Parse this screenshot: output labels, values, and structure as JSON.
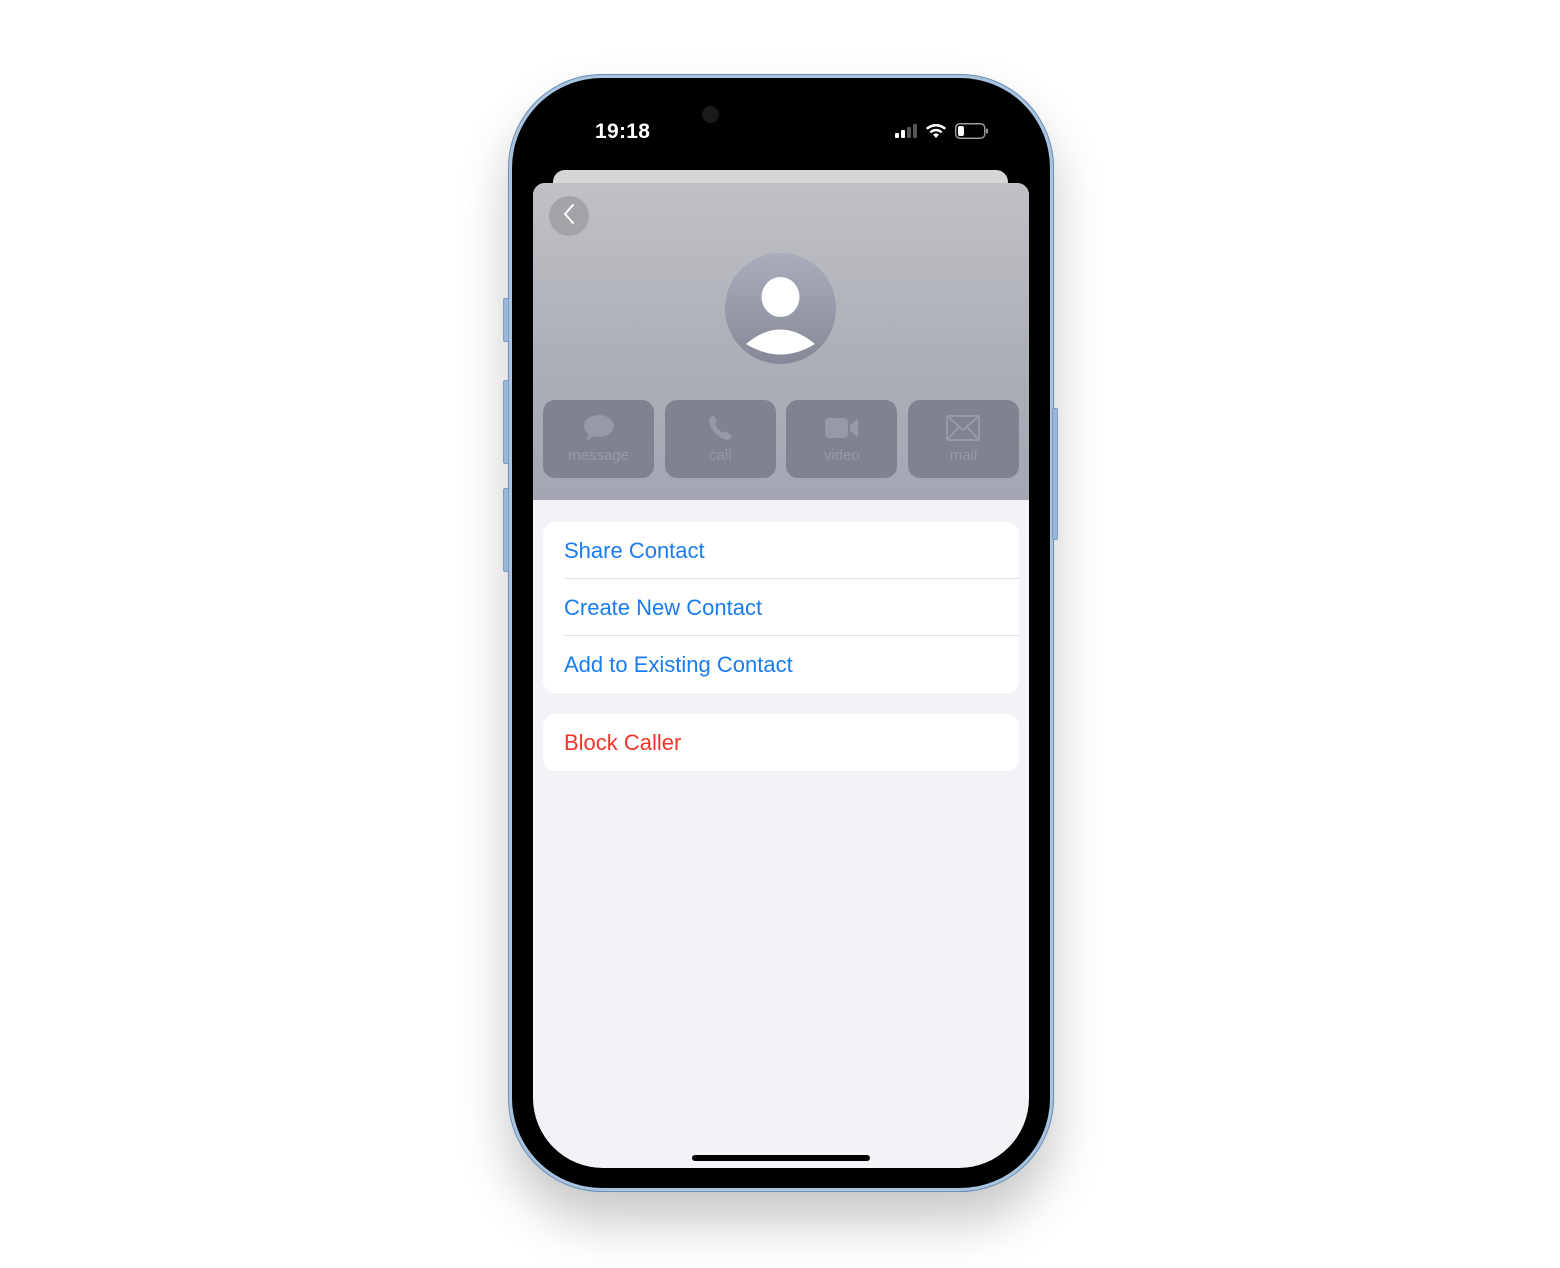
{
  "status_bar": {
    "time": "19:18",
    "icons": [
      "cellular-signal-icon",
      "wifi-icon",
      "battery-icon"
    ]
  },
  "header": {
    "back_icon": "chevron-left-icon",
    "avatar_icon": "person-silhouette-icon"
  },
  "actions": [
    {
      "label": "message",
      "icon": "speech-bubble-icon"
    },
    {
      "label": "call",
      "icon": "phone-icon"
    },
    {
      "label": "video",
      "icon": "video-camera-icon"
    },
    {
      "label": "mail",
      "icon": "envelope-icon"
    }
  ],
  "menu": {
    "contact_options": [
      {
        "label": "Share Contact"
      },
      {
        "label": "Create New Contact"
      },
      {
        "label": "Add to Existing Contact"
      }
    ],
    "block": {
      "label": "Block Caller"
    }
  },
  "colors": {
    "link_blue": "#1a7cf0",
    "destructive_red": "#f3342a",
    "background": "#f2f2f7"
  }
}
